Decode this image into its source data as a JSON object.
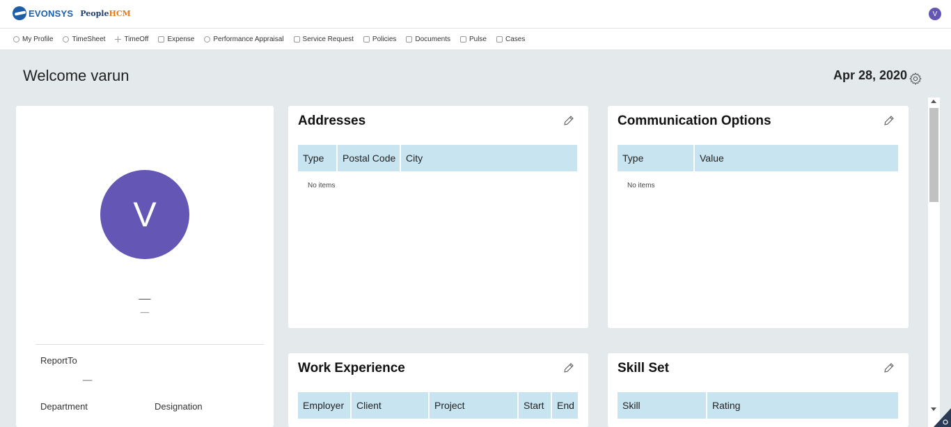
{
  "brand": {
    "logo_text": "EVONSYS",
    "product_a": "People",
    "product_b": "HCM"
  },
  "user": {
    "initial": "V"
  },
  "nav": [
    {
      "label": "My Profile",
      "icon": "person-icon"
    },
    {
      "label": "TimeSheet",
      "icon": "clock-icon"
    },
    {
      "label": "TimeOff",
      "icon": "plus-icon"
    },
    {
      "label": "Expense",
      "icon": "bank-icon"
    },
    {
      "label": "Performance Appraisal",
      "icon": "gauge-icon"
    },
    {
      "label": "Service Request",
      "icon": "wrench-icon"
    },
    {
      "label": "Policies",
      "icon": "grid-icon"
    },
    {
      "label": "Documents",
      "icon": "document-icon"
    },
    {
      "label": "Pulse",
      "icon": "chat-icon"
    },
    {
      "label": "Cases",
      "icon": "briefcase-icon"
    }
  ],
  "header": {
    "welcome": "Welcome varun",
    "date": "Apr 28, 2020"
  },
  "profile": {
    "avatar_initial": "V",
    "name": "__",
    "subtitle": "__",
    "report_to_label": "ReportTo",
    "report_to_value": "__",
    "department_label": "Department",
    "designation_label": "Designation"
  },
  "addresses": {
    "title": "Addresses",
    "columns": [
      "Type",
      "Postal Code",
      "City"
    ],
    "empty": "No items"
  },
  "communication": {
    "title": "Communication Options",
    "columns": [
      "Type",
      "Value"
    ],
    "empty": "No items"
  },
  "work": {
    "title": "Work Experience",
    "columns": [
      "Employer",
      "Client",
      "Project",
      "Start",
      "End"
    ]
  },
  "skills": {
    "title": "Skill Set",
    "columns": [
      "Skill",
      "Rating"
    ]
  },
  "colors": {
    "accent": "#6356b5",
    "table_header": "#c8e4f1",
    "background": "#e4e9ec"
  }
}
